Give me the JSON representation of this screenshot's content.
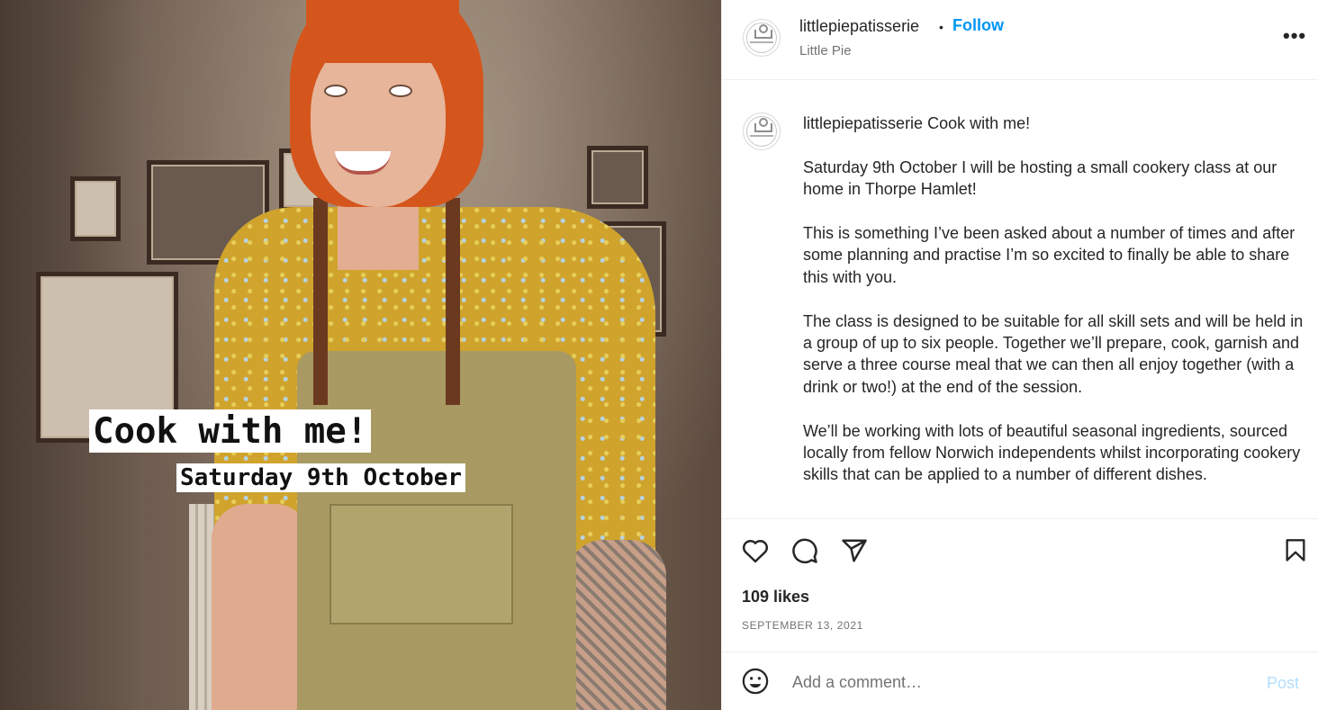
{
  "photo": {
    "caption_main": "Cook with me!",
    "caption_sub": "Saturday 9th October"
  },
  "header": {
    "username": "littlepiepatisserie",
    "separator": "•",
    "follow_label": "Follow",
    "subtitle": "Little Pie",
    "more_icon": "more-options-icon"
  },
  "caption": {
    "username": "littlepiepatisserie",
    "first_line": "Cook with me!",
    "paragraphs": [
      "Saturday 9th October I will be hosting a small cookery class at our home in Thorpe Hamlet!",
      "This is something I’ve been asked about a number of times and after some planning and practise I’m so excited to finally be able to share this with you.",
      "The class is designed to be suitable for all skill sets and will be held in a group of up to six people. Together we’ll prepare, cook, garnish and serve a three course meal that we can then all enjoy together (with a drink or two!) at the end of the session.",
      "We’ll be working with lots of beautiful seasonal ingredients, sourced locally from fellow Norwich independents whilst incorporating cookery skills that can be applied to a number of different dishes."
    ]
  },
  "actions": {
    "icons": [
      "heart-icon",
      "comment-icon",
      "share-icon",
      "bookmark-icon"
    ],
    "likes": "109 likes",
    "date": "SEPTEMBER 13, 2021"
  },
  "composer": {
    "placeholder": "Add a comment…",
    "post_label": "Post",
    "emoji_icon": "emoji-icon"
  },
  "colors": {
    "follow_blue": "#0095f6",
    "post_disabled": "#b2dffc",
    "text": "#262626",
    "secondary": "#737373",
    "divider": "#efefef"
  }
}
